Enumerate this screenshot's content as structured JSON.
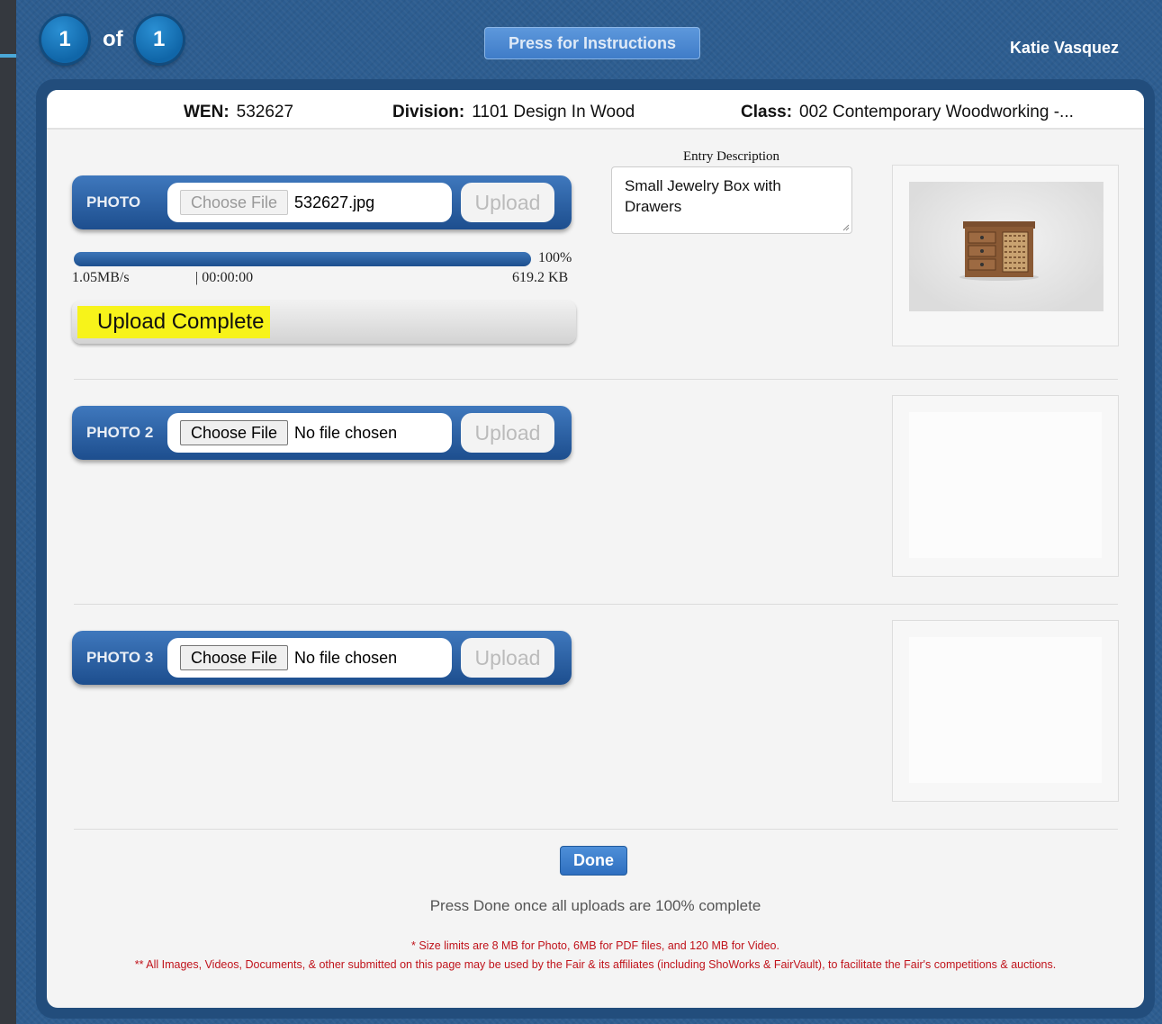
{
  "header": {
    "current_entry": "1",
    "of_text": "of",
    "total_entries": "1",
    "instructions_label": "Press for Instructions",
    "user_name": "Katie Vasquez"
  },
  "entry": {
    "wen_label": "WEN:",
    "wen_value": "532627",
    "division_label": "Division:",
    "division_value": "1101 Design In Wood",
    "class_label": "Class:",
    "class_value": "002 Contemporary Woodworking -..."
  },
  "description": {
    "label": "Entry Description",
    "text": "Small Jewelry Box with Drawers"
  },
  "uploads": [
    {
      "label": "PHOTO",
      "choose_label": "Choose File",
      "file_name": "532627.jpg",
      "upload_label": "Upload"
    },
    {
      "label": "PHOTO 2",
      "choose_label": "Choose File",
      "file_name": "No file chosen",
      "upload_label": "Upload"
    },
    {
      "label": "PHOTO 3",
      "choose_label": "Choose File",
      "file_name": "No file chosen",
      "upload_label": "Upload"
    }
  ],
  "progress": {
    "percent": 100,
    "percent_text": "100%",
    "speed": "1.05MB/s",
    "time": "| 00:00:00",
    "size": "619.2 KB",
    "status": "Upload Complete"
  },
  "footer": {
    "done_label": "Done",
    "done_note": "Press Done once all uploads are 100% complete",
    "size_note": "* Size limits are 8 MB for Photo, 6MB for PDF files, and 120 MB for Video.",
    "usage_note": "** All Images, Videos, Documents, & other submitted on this page may be used by the Fair & its affiliates (including ShoWorks & FairVault), to facilitate the Fair's competitions & auctions."
  }
}
